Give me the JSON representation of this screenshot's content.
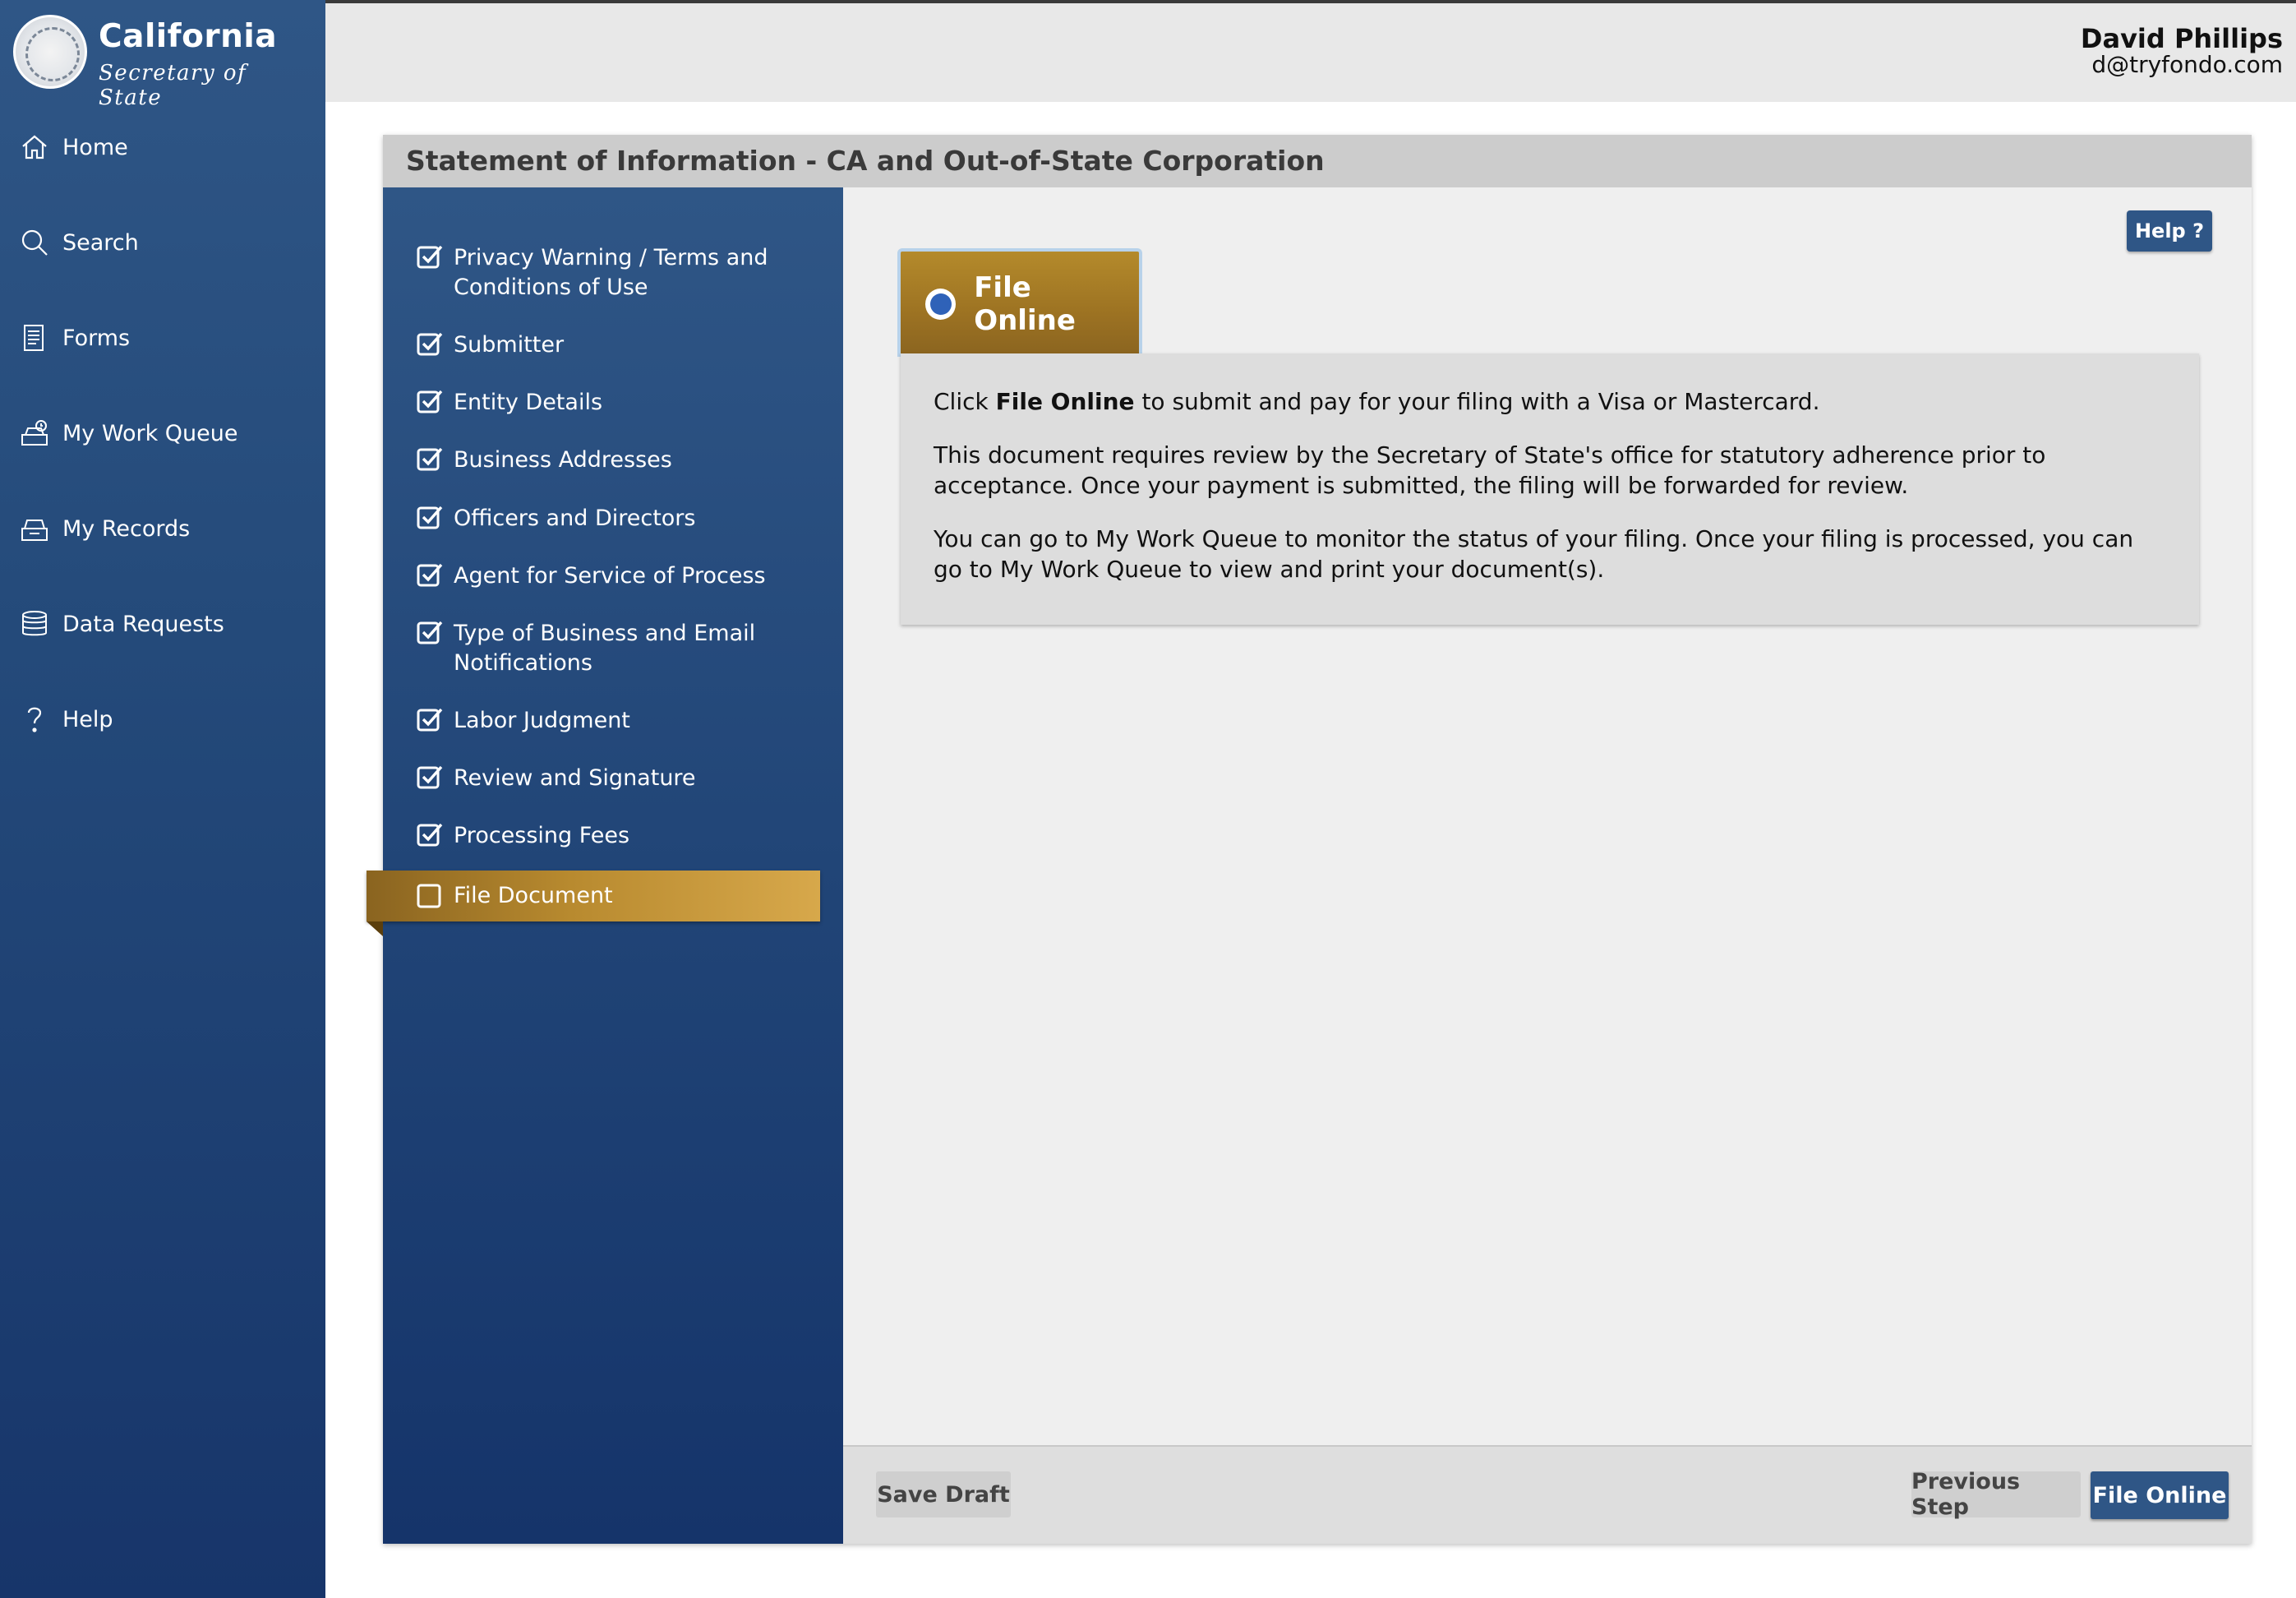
{
  "brand": {
    "title": "California",
    "subtitle": "Secretary of State"
  },
  "sidebar": {
    "items": [
      {
        "label": "Home",
        "icon": "home-icon"
      },
      {
        "label": "Search",
        "icon": "search-icon"
      },
      {
        "label": "Forms",
        "icon": "forms-icon"
      },
      {
        "label": "My Work Queue",
        "icon": "work-queue-icon"
      },
      {
        "label": "My Records",
        "icon": "records-icon"
      },
      {
        "label": "Data Requests",
        "icon": "database-icon"
      },
      {
        "label": "Help",
        "icon": "question-icon"
      }
    ]
  },
  "header": {
    "user_name": "David Phillips",
    "user_email": "d@tryfondo.com",
    "cart_icon": "cart-icon"
  },
  "form": {
    "title": "Statement of Information - CA and Out-of-State Corporation",
    "steps": [
      {
        "label": "Privacy Warning / Terms and Conditions of Use",
        "checked": true
      },
      {
        "label": "Submitter",
        "checked": true
      },
      {
        "label": "Entity Details",
        "checked": true
      },
      {
        "label": "Business Addresses",
        "checked": true
      },
      {
        "label": "Officers and Directors",
        "checked": true
      },
      {
        "label": "Agent for Service of Process",
        "checked": true
      },
      {
        "label": "Type of Business and Email Notifications",
        "checked": true
      },
      {
        "label": "Labor Judgment",
        "checked": true
      },
      {
        "label": "Review and Signature",
        "checked": true
      },
      {
        "label": "Processing Fees",
        "checked": true
      },
      {
        "label": "File Document",
        "checked": false
      }
    ],
    "help_label": "Help ?",
    "option_label": "File Online",
    "info": {
      "p1_prefix": "Click ",
      "p1_bold": "File Online",
      "p1_suffix": " to submit and pay for your filing with a Visa or Mastercard.",
      "p2": "This document requires review by the Secretary of State's office for statutory adherence prior to acceptance. Once your payment is submitted, the filing will be forwarded for review.",
      "p3": "You can go to My Work Queue to monitor the status of your filing. Once your filing is processed, you can go to My Work Queue to view and print your document(s)."
    },
    "footer": {
      "save_draft": "Save Draft",
      "previous_step": "Previous Step",
      "file_online": "File Online"
    }
  },
  "colors": {
    "navy": "#2f5686",
    "gold": "#b48a2b",
    "radio_blue": "#2f62b8"
  }
}
